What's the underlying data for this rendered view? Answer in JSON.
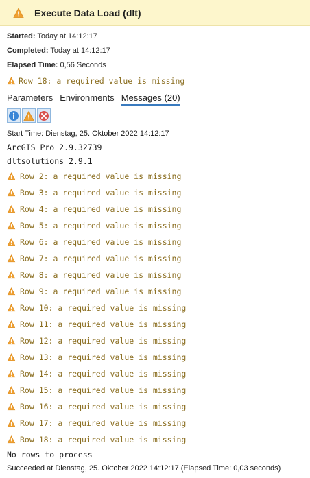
{
  "header": {
    "title": "Execute Data Load (dlt)",
    "icon": "warning-icon"
  },
  "meta": {
    "started_label": "Started:",
    "started_value": "Today at 14:12:17",
    "completed_label": "Completed:",
    "completed_value": "Today at 14:12:17",
    "elapsed_label": "Elapsed Time:",
    "elapsed_value": "0,56 Seconds"
  },
  "summary_warning": "Row 18: a required value is missing",
  "tabs": [
    "Parameters",
    "Environments",
    "Messages (20)"
  ],
  "filters": [
    "info-filter-icon",
    "warning-filter-icon",
    "error-filter-icon"
  ],
  "messages": {
    "start_time": "Start Time: Dienstag, 25. Oktober 2022 14:12:17",
    "arcgis": "ArcGIS Pro 2.9.32739",
    "dlt": "dltsolutions 2.9.1",
    "warnings": [
      "Row 2: a required value is missing",
      "Row 3: a required value is missing",
      "Row 4: a required value is missing",
      "Row 5: a required value is missing",
      "Row 6: a required value is missing",
      "Row 7: a required value is missing",
      "Row 8: a required value is missing",
      "Row 9: a required value is missing",
      "Row 10: a required value is missing",
      "Row 11: a required value is missing",
      "Row 12: a required value is missing",
      "Row 13: a required value is missing",
      "Row 14: a required value is missing",
      "Row 15: a required value is missing",
      "Row 16: a required value is missing",
      "Row 17: a required value is missing",
      "Row 18: a required value is missing"
    ],
    "no_rows": "No rows to process",
    "succeeded": "Succeeded at Dienstag, 25. Oktober 2022 14:12:17 (Elapsed Time: 0,03 seconds)"
  },
  "colors": {
    "header_bg": "#fdf6cc",
    "warning": "#f0a030",
    "warning_text": "#8a6d1f",
    "tab_underline": "#3a7bbf",
    "error": "#d9534f",
    "info": "#3a86d6"
  }
}
